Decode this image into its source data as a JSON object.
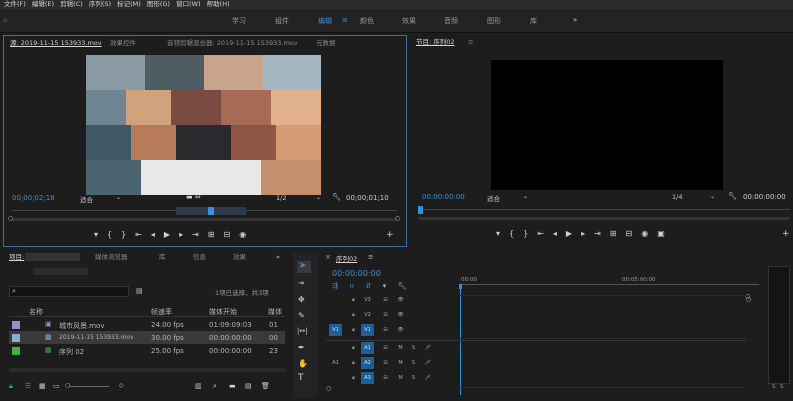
{
  "menu": [
    "文件(F)",
    "编辑(E)",
    "剪辑(C)",
    "序列(S)",
    "标记(M)",
    "图形(G)",
    "窗口(W)",
    "帮助(H)"
  ],
  "workspaces": {
    "items": [
      "学习",
      "组件",
      "编辑",
      "颜色",
      "效果",
      "音频",
      "图形",
      "库"
    ],
    "active": "编辑",
    "more": "»"
  },
  "source": {
    "tabs": [
      "源: 2019-11-15 153933.mov",
      "效果控件",
      "音频剪辑混合器: 2019-11-15 153933.mov",
      "元数据"
    ],
    "timecode_in": "00;00;02;18",
    "fit": "适合",
    "resolution": "1/2",
    "timecode_dur": "00;00;01;10"
  },
  "program": {
    "tab": "节目: 序列02",
    "timecode": "00:00:00:00",
    "fit": "适合",
    "resolution": "1/4",
    "duration": "00:00:00:00"
  },
  "project": {
    "tabs": [
      "项目:",
      "媒体浏览器",
      "库",
      "信息",
      "效果"
    ],
    "selection_info": "1项已选择，共3项",
    "columns": [
      "名称",
      "帧速率",
      "媒体开始",
      "媒体"
    ],
    "rows": [
      {
        "color": "#9b8ad6",
        "name": "城市风景.mov",
        "fps": "24.00 fps",
        "start": "01:09:09:03",
        "extra": "01"
      },
      {
        "color": "#8ab0d6",
        "name": "2019-11-15 153933.mov",
        "fps": "30.00 fps",
        "start": "00:00:00:00",
        "extra": "00"
      },
      {
        "color": "#39b54a",
        "name": "序列 02",
        "fps": "25.00 fps",
        "start": "00:00:00:00",
        "extra": "23"
      }
    ]
  },
  "timeline": {
    "tab": "序列02",
    "timecode": "00:00:00:00",
    "ruler": [
      "00:00",
      "00:05:00:00"
    ],
    "video_tracks": [
      "V3",
      "V2",
      "V1"
    ],
    "audio_tracks": [
      "A1",
      "A2",
      "A3"
    ],
    "source_v": "V1",
    "source_a": "A1"
  },
  "meter_labels": [
    "S",
    "S"
  ]
}
